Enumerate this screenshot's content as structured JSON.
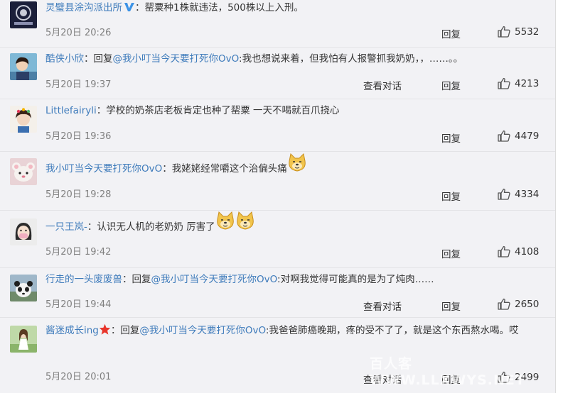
{
  "comments": [
    {
      "user": "灵璧县涂沟派出所",
      "verified": true,
      "colon": "：",
      "text": "罂粟种1株就违法，500株以上入刑。",
      "time": "5月20日 20:26",
      "reply_label": "回复",
      "likes": "5532"
    },
    {
      "user": "酷侠小欣",
      "colon": "：",
      "reply_prefix": "回复",
      "mention": "@我小叮当今天要打死你OvO",
      "text": ":我也想说来着，但我怕有人报警抓我奶奶，，……。。",
      "time": "5月20日 19:37",
      "convo_label": "查看对话",
      "reply_label": "回复",
      "likes": "4213"
    },
    {
      "user": "Littlefairyli",
      "colon": "：",
      "text": "学校的奶茶店老板肯定也种了罂粟 一天不喝就百爪挠心",
      "time": "5月20日 19:36",
      "reply_label": "回复",
      "likes": "4479"
    },
    {
      "user": "我小叮当今天要打死你OvO",
      "colon": "：",
      "text": "我姥姥经常嚼这个治偏头痛",
      "time": "5月20日 19:28",
      "reply_label": "回复",
      "likes": "4334"
    },
    {
      "user": "一只王岚-",
      "colon": "：",
      "text": "认识无人机的老奶奶 厉害了",
      "time": "5月20日 19:42",
      "reply_label": "回复",
      "likes": "4108"
    },
    {
      "user": "行走的一头废废兽",
      "colon": "：",
      "reply_prefix": "回复",
      "mention": "@我小叮当今天要打死你OvO",
      "text": ":对啊我觉得可能真的是为了炖肉……",
      "time": "5月20日 19:44",
      "convo_label": "查看对话",
      "reply_label": "回复",
      "likes": "2650"
    },
    {
      "user": "酱迷成长ing",
      "colon": "：",
      "reply_prefix": "回复",
      "mention": "@我小叮当今天要打死你OvO",
      "text": ":我爸爸肺癌晚期，疼的受不了了，就是这个东西熬水喝。哎",
      "time": "5月20日 20:01",
      "convo_label": "查看对话",
      "reply_label": "回复",
      "likes": "2499"
    }
  ],
  "watermark": "百人客WWW.LLXWYS.NET",
  "colors": {
    "link": "#3e7bbb",
    "text": "#333333",
    "meta": "#808080",
    "background": "#f2f2f5",
    "verified_badge": "#3d93e6",
    "star": "#e8352b"
  },
  "icons": {
    "like": "thumbs-up-icon",
    "verified": "verified-v-icon",
    "emoji": "doge-emoji-icon",
    "star": "star-icon"
  }
}
